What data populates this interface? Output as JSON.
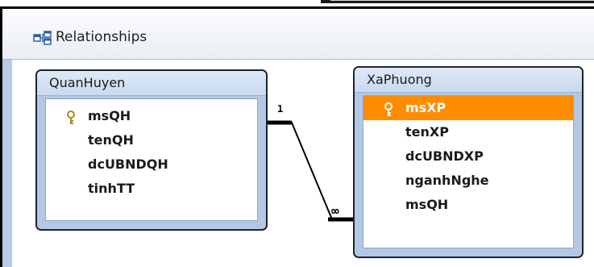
{
  "window": {
    "title": "Relationships",
    "title_icon": "relationships-icon"
  },
  "tables": [
    {
      "name": "QuanHuyen",
      "fields": [
        {
          "name": "msQH",
          "primary_key": true,
          "selected": false
        },
        {
          "name": "tenQH",
          "primary_key": false,
          "selected": false
        },
        {
          "name": "dcUBNDQH",
          "primary_key": false,
          "selected": false
        },
        {
          "name": "tinhTT",
          "primary_key": false,
          "selected": false
        }
      ]
    },
    {
      "name": "XaPhuong",
      "fields": [
        {
          "name": "msXP",
          "primary_key": true,
          "selected": true
        },
        {
          "name": "tenXP",
          "primary_key": false,
          "selected": false
        },
        {
          "name": "dcUBNDXP",
          "primary_key": false,
          "selected": false
        },
        {
          "name": "nganhNghe",
          "primary_key": false,
          "selected": false
        },
        {
          "name": "msQH",
          "primary_key": false,
          "selected": false
        }
      ]
    }
  ],
  "relationship": {
    "from_table": "QuanHuyen",
    "from_field": "msQH",
    "to_table": "XaPhuong",
    "to_field": "msQH",
    "one_label": "1",
    "many_label": "∞"
  },
  "colors": {
    "selected_row": "#ff8c00",
    "table_frame": "#b3c8e4",
    "key_icon": "#c9a21a"
  }
}
